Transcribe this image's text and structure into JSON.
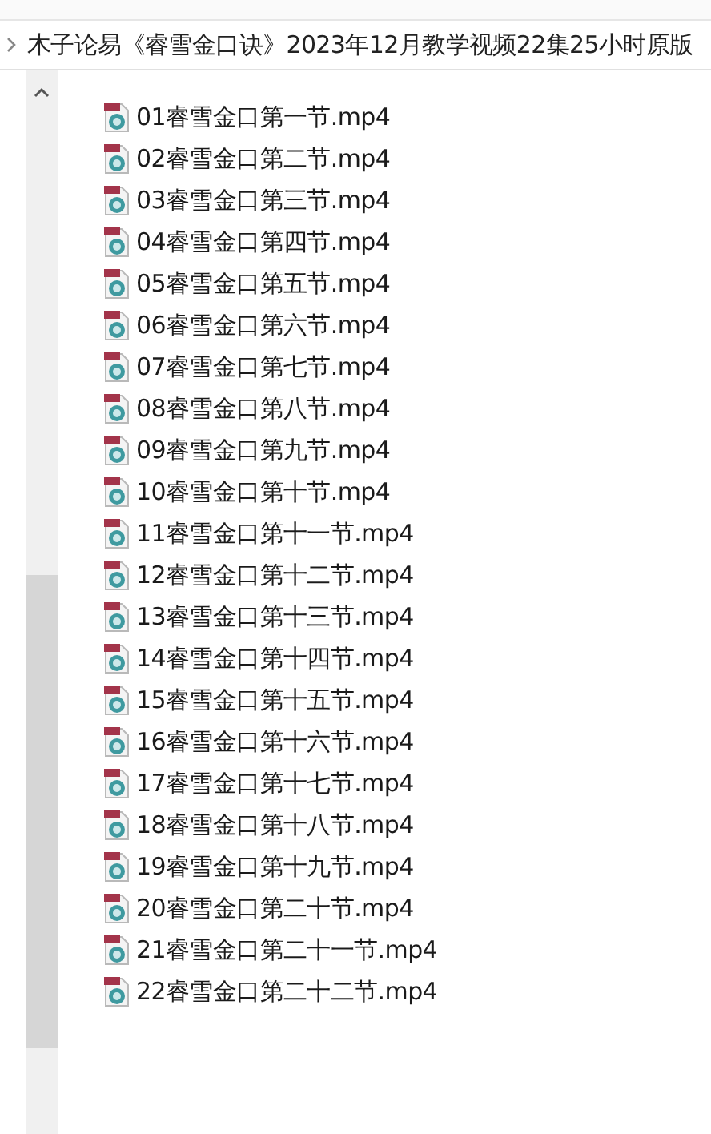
{
  "address_bar": {
    "path": "木子论易《睿雪金口诀》2023年12月教学视频22集25小时原版"
  },
  "files": [
    {
      "name": "01睿雪金口第一节.mp4"
    },
    {
      "name": "02睿雪金口第二节.mp4"
    },
    {
      "name": "03睿雪金口第三节.mp4"
    },
    {
      "name": "04睿雪金口第四节.mp4"
    },
    {
      "name": "05睿雪金口第五节.mp4"
    },
    {
      "name": "06睿雪金口第六节.mp4"
    },
    {
      "name": "07睿雪金口第七节.mp4"
    },
    {
      "name": "08睿雪金口第八节.mp4"
    },
    {
      "name": "09睿雪金口第九节.mp4"
    },
    {
      "name": "10睿雪金口第十节.mp4"
    },
    {
      "name": "11睿雪金口第十一节.mp4"
    },
    {
      "name": "12睿雪金口第十二节.mp4"
    },
    {
      "name": "13睿雪金口第十三节.mp4"
    },
    {
      "name": "14睿雪金口第十四节.mp4"
    },
    {
      "name": "15睿雪金口第十五节.mp4"
    },
    {
      "name": "16睿雪金口第十六节.mp4"
    },
    {
      "name": "17睿雪金口第十七节.mp4"
    },
    {
      "name": "18睿雪金口第十八节.mp4"
    },
    {
      "name": "19睿雪金口第十九节.mp4"
    },
    {
      "name": "20睿雪金口第二十节.mp4"
    },
    {
      "name": "21睿雪金口第二十一节.mp4"
    },
    {
      "name": "22睿雪金口第二十二节.mp4"
    }
  ]
}
